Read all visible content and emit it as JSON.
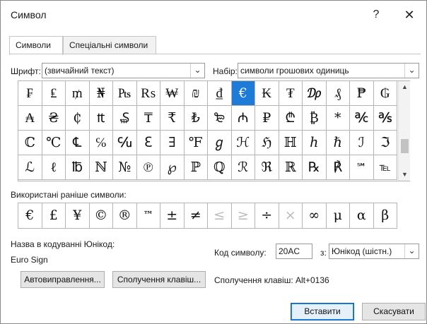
{
  "dialog": {
    "title": "Символ",
    "help_glyph": "?",
    "close_glyph": "✕"
  },
  "tabs": [
    {
      "label": "Символи",
      "active": true
    },
    {
      "label": "Спеціальні символи",
      "active": false
    }
  ],
  "font": {
    "label": "Шрифт:",
    "value": "(звичайний текст)"
  },
  "subset": {
    "label": "Набір:",
    "value": "символи грошових одиниць"
  },
  "symbol_grid": {
    "selected_index": 9,
    "cells": [
      "₣",
      "₤",
      "₥",
      "₦",
      "₧",
      "₨",
      "₩",
      "₪",
      "₫",
      "€",
      "₭",
      "₮",
      "₯",
      "₰",
      "₱",
      "₲",
      "₳",
      "₴",
      "₵",
      "₶",
      "₷",
      "₸",
      "₹",
      "₺",
      "₻",
      "₼",
      "₽",
      "₾",
      "₿",
      "*",
      "℀",
      "℁",
      "ℂ",
      "℃",
      "℄",
      "℅",
      "℆",
      "ℇ",
      "∃",
      "℉",
      "ℊ",
      "ℋ",
      "ℌ",
      "ℍ",
      "ℎ",
      "ℏ",
      "ℐ",
      "ℑ",
      "ℒ",
      "ℓ",
      "℔",
      "ℕ",
      "№",
      "℗",
      "℘",
      "ℙ",
      "ℚ",
      "ℛ",
      "ℜ",
      "ℝ",
      "℞",
      "℟",
      "℠",
      "℡"
    ]
  },
  "recent": {
    "label": "Використані раніше символи:",
    "cells": [
      "€",
      "£",
      "¥",
      "©",
      "®",
      "™",
      "±",
      "≠",
      "≤",
      "≥",
      "÷",
      "×",
      "∞",
      "μ",
      "α",
      "β"
    ]
  },
  "unicode_name": {
    "label": "Назва в кодуванні Юнікод:",
    "value": "Euro Sign"
  },
  "char_code": {
    "label": "Код символу:",
    "value": "20AC"
  },
  "from": {
    "label": "з:",
    "value": "Юнікод (шістн.)"
  },
  "buttons": {
    "autocorrect": "Автовиправлення...",
    "shortcut_key": "Сполучення клавіш...",
    "insert": "Вставити",
    "cancel": "Скасувати"
  },
  "shortcut_text": "Сполучення клавіш: Alt+0136",
  "icons": {
    "dropdown_arrow": "chevron-down-icon",
    "scroll_up": "scroll-up-icon",
    "scroll_down": "scroll-down-icon"
  },
  "colors": {
    "selection": "#1e7bd8",
    "accent_border": "#0a64c8"
  }
}
